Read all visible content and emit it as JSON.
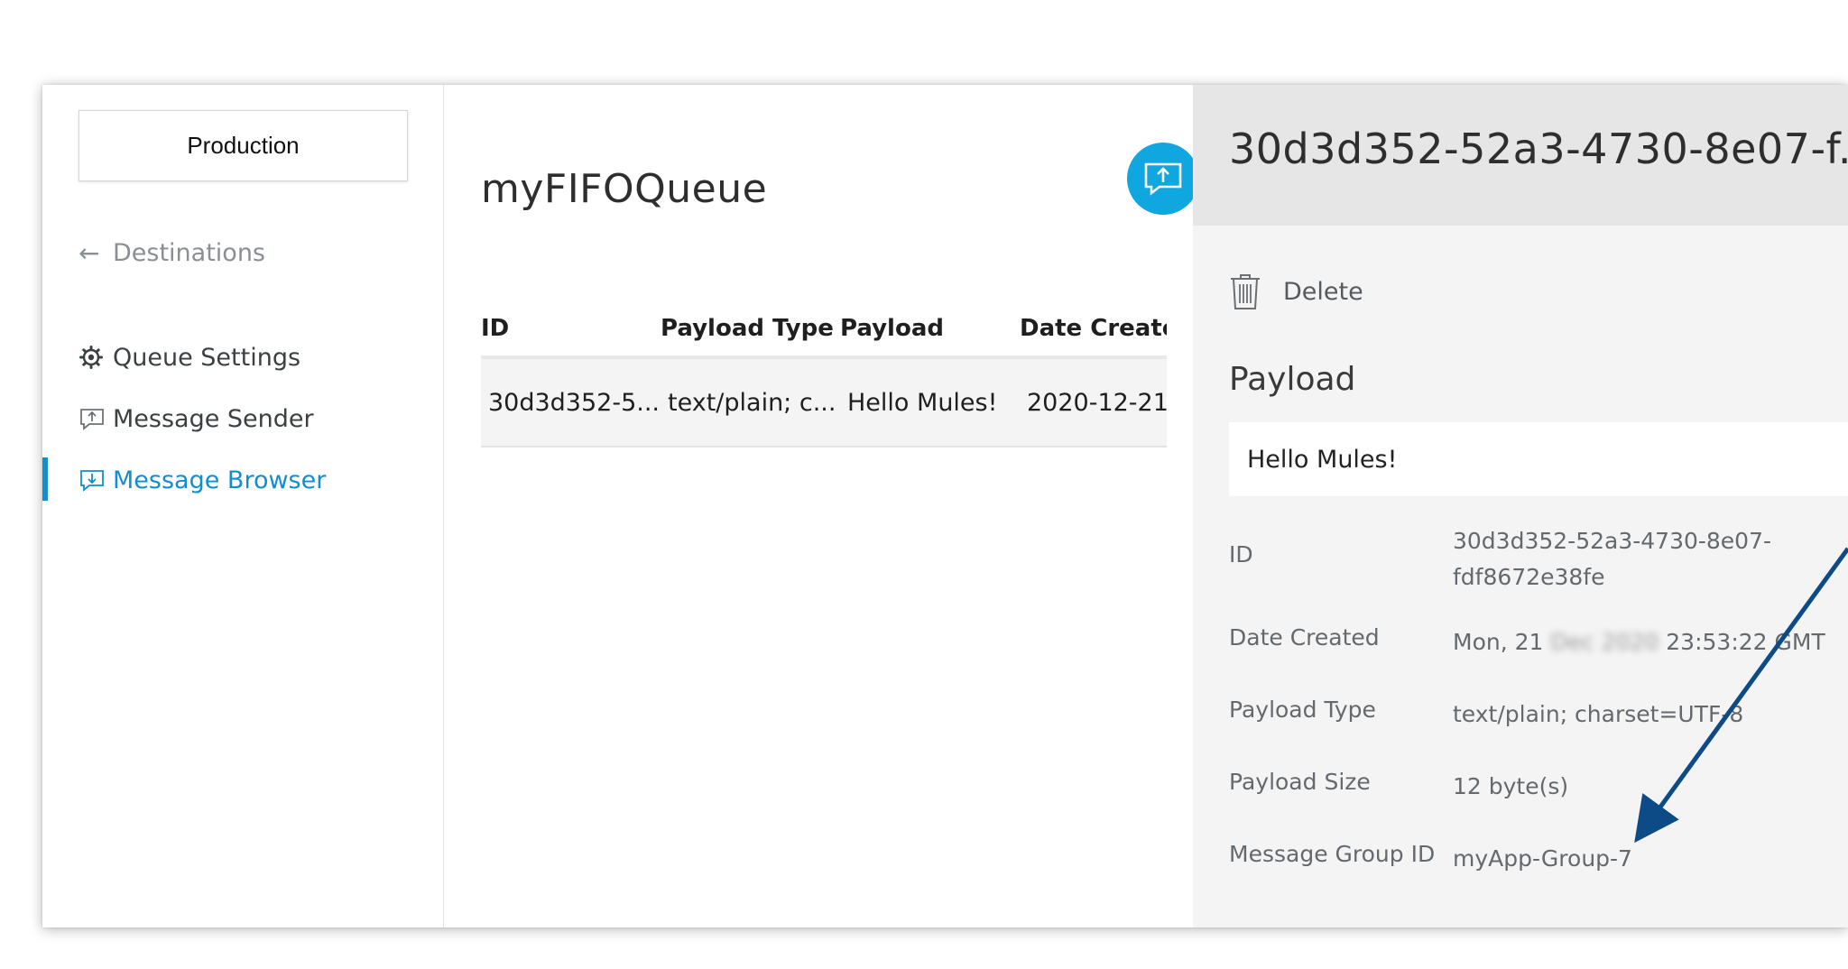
{
  "sidebar": {
    "environment": "Production",
    "back_label": "Destinations",
    "items": [
      {
        "label": "Queue Settings",
        "icon": "gear-icon"
      },
      {
        "label": "Message Sender",
        "icon": "send-message-icon"
      },
      {
        "label": "Message Browser",
        "icon": "browse-message-icon",
        "active": true
      }
    ]
  },
  "main": {
    "queue_name": "myFIFOQueue",
    "table": {
      "headers": [
        "ID",
        "Payload Type",
        "Payload",
        "Date Create"
      ],
      "rows": [
        [
          "30d3d352-5...",
          "text/plain; c...",
          "Hello Mules!",
          "2020-12-21"
        ]
      ]
    }
  },
  "detail": {
    "title": "30d3d352-52a3-4730-8e07-f...",
    "close_glyph": "×",
    "delete_label": "Delete",
    "payload_label": "Payload",
    "payload_value": "Hello Mules!",
    "fields": {
      "id": {
        "label": "ID",
        "value_line1": "30d3d352-52a3-4730-8e07-",
        "value_line2": "fdf8672e38fe"
      },
      "date": {
        "label": "Date Created",
        "value_prefix": "Mon, 21",
        "value_blurred": "Dec 2020",
        "value_suffix": "23:53:22 GMT"
      },
      "type": {
        "label": "Payload Type",
        "value": "text/plain; charset=UTF-8"
      },
      "size": {
        "label": "Payload Size",
        "value": "12 byte(s)"
      },
      "group": {
        "label": "Message Group ID",
        "value": "myApp-Group-7"
      }
    }
  },
  "colors": {
    "accent": "#0f8fd1",
    "send_button": "#10a6e0",
    "annotation_arrow": "#0d4b86"
  }
}
